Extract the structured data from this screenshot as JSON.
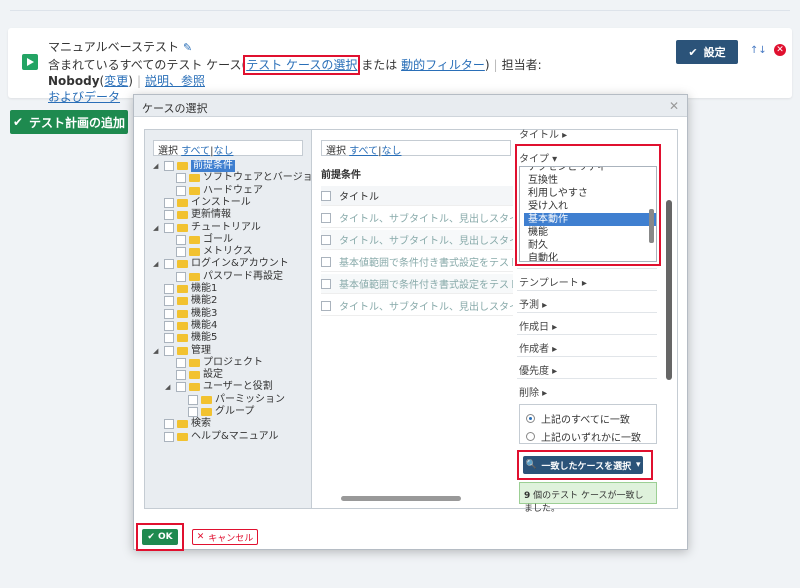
{
  "page": {
    "title": "マニュアルベーステスト",
    "desc_prefix": "含まれているすべてのテスト ケース(",
    "link_select": "テスト ケースの選択",
    "or_text": " または ",
    "link_filter": "動的フィルター",
    "close_paren": ")",
    "assignee_label": "担当者:",
    "assignee": "Nobody",
    "change_open": "(",
    "change": "変更",
    "change_close": ")",
    "link_desc": "説明、参照",
    "link_data": "およびデータ",
    "set_label": "設定",
    "add_plan_label": "テスト計画の追加"
  },
  "dialog": {
    "title": "ケースの選択",
    "select_label": "選択",
    "all": "すべて",
    "pipe": "|",
    "none": "なし",
    "mid_header": "前提条件",
    "rows": [
      "タイトル",
      "タイトル、サブタイトル、見出しスタイルを確認する",
      "タイトル、サブタイトル、見出しスタイルを確認する",
      "基本値範囲で条件付き書式設定をテストする",
      "基本値範囲で条件付き書式設定をテストする",
      "タイトル、サブタイトル、見出しスタイルを確認する"
    ],
    "tree": [
      {
        "label": "前提条件",
        "level": 0,
        "exp": "▲",
        "sel": true
      },
      {
        "label": "ソフトウェアとバージョン",
        "level": 1
      },
      {
        "label": "ハードウェア",
        "level": 1
      },
      {
        "label": "インストール",
        "level": 0
      },
      {
        "label": "更新情報",
        "level": 0
      },
      {
        "label": "チュートリアル",
        "level": 0,
        "exp": "▲"
      },
      {
        "label": "ゴール",
        "level": 1
      },
      {
        "label": "メトリクス",
        "level": 1
      },
      {
        "label": "ログイン&アカウント",
        "level": 0,
        "exp": "▲"
      },
      {
        "label": "パスワード再設定",
        "level": 1
      },
      {
        "label": "機能1",
        "level": 0
      },
      {
        "label": "機能2",
        "level": 0
      },
      {
        "label": "機能3",
        "level": 0
      },
      {
        "label": "機能4",
        "level": 0
      },
      {
        "label": "機能5",
        "level": 0
      },
      {
        "label": "管理",
        "level": 0,
        "exp": "▲"
      },
      {
        "label": "プロジェクト",
        "level": 1
      },
      {
        "label": "設定",
        "level": 1
      },
      {
        "label": "ユーザーと役割",
        "level": 1,
        "exp": "▲"
      },
      {
        "label": "パーミッション",
        "level": 2
      },
      {
        "label": "グループ",
        "level": 2
      },
      {
        "label": "検索",
        "level": 0
      },
      {
        "label": "ヘルプ&マニュアル",
        "level": 0
      }
    ],
    "filters": {
      "title_label": "タイトル",
      "type_label": "タイプ",
      "type_options": [
        "アクセシビリティ",
        "互換性",
        "利用しやすさ",
        "受け入れ",
        "基本動作",
        "機能",
        "耐久",
        "自動化"
      ],
      "selected": "基本動作",
      "others": [
        "テンプレート",
        "予測",
        "作成日",
        "作成者",
        "優先度",
        "削除"
      ],
      "match_all": "上記のすべてに一致",
      "match_any": "上記のいずれかに一致",
      "select_btn": "一致したケースを選択",
      "match_msg_count": "9",
      "match_msg": " 個のテスト ケースが一致しました。"
    },
    "ok": "OK",
    "cancel": "キャンセル"
  },
  "colors": {
    "primary": "#2b5379",
    "green": "#1e8a4f",
    "red": "#e0102f",
    "link": "#2a6fb8"
  }
}
